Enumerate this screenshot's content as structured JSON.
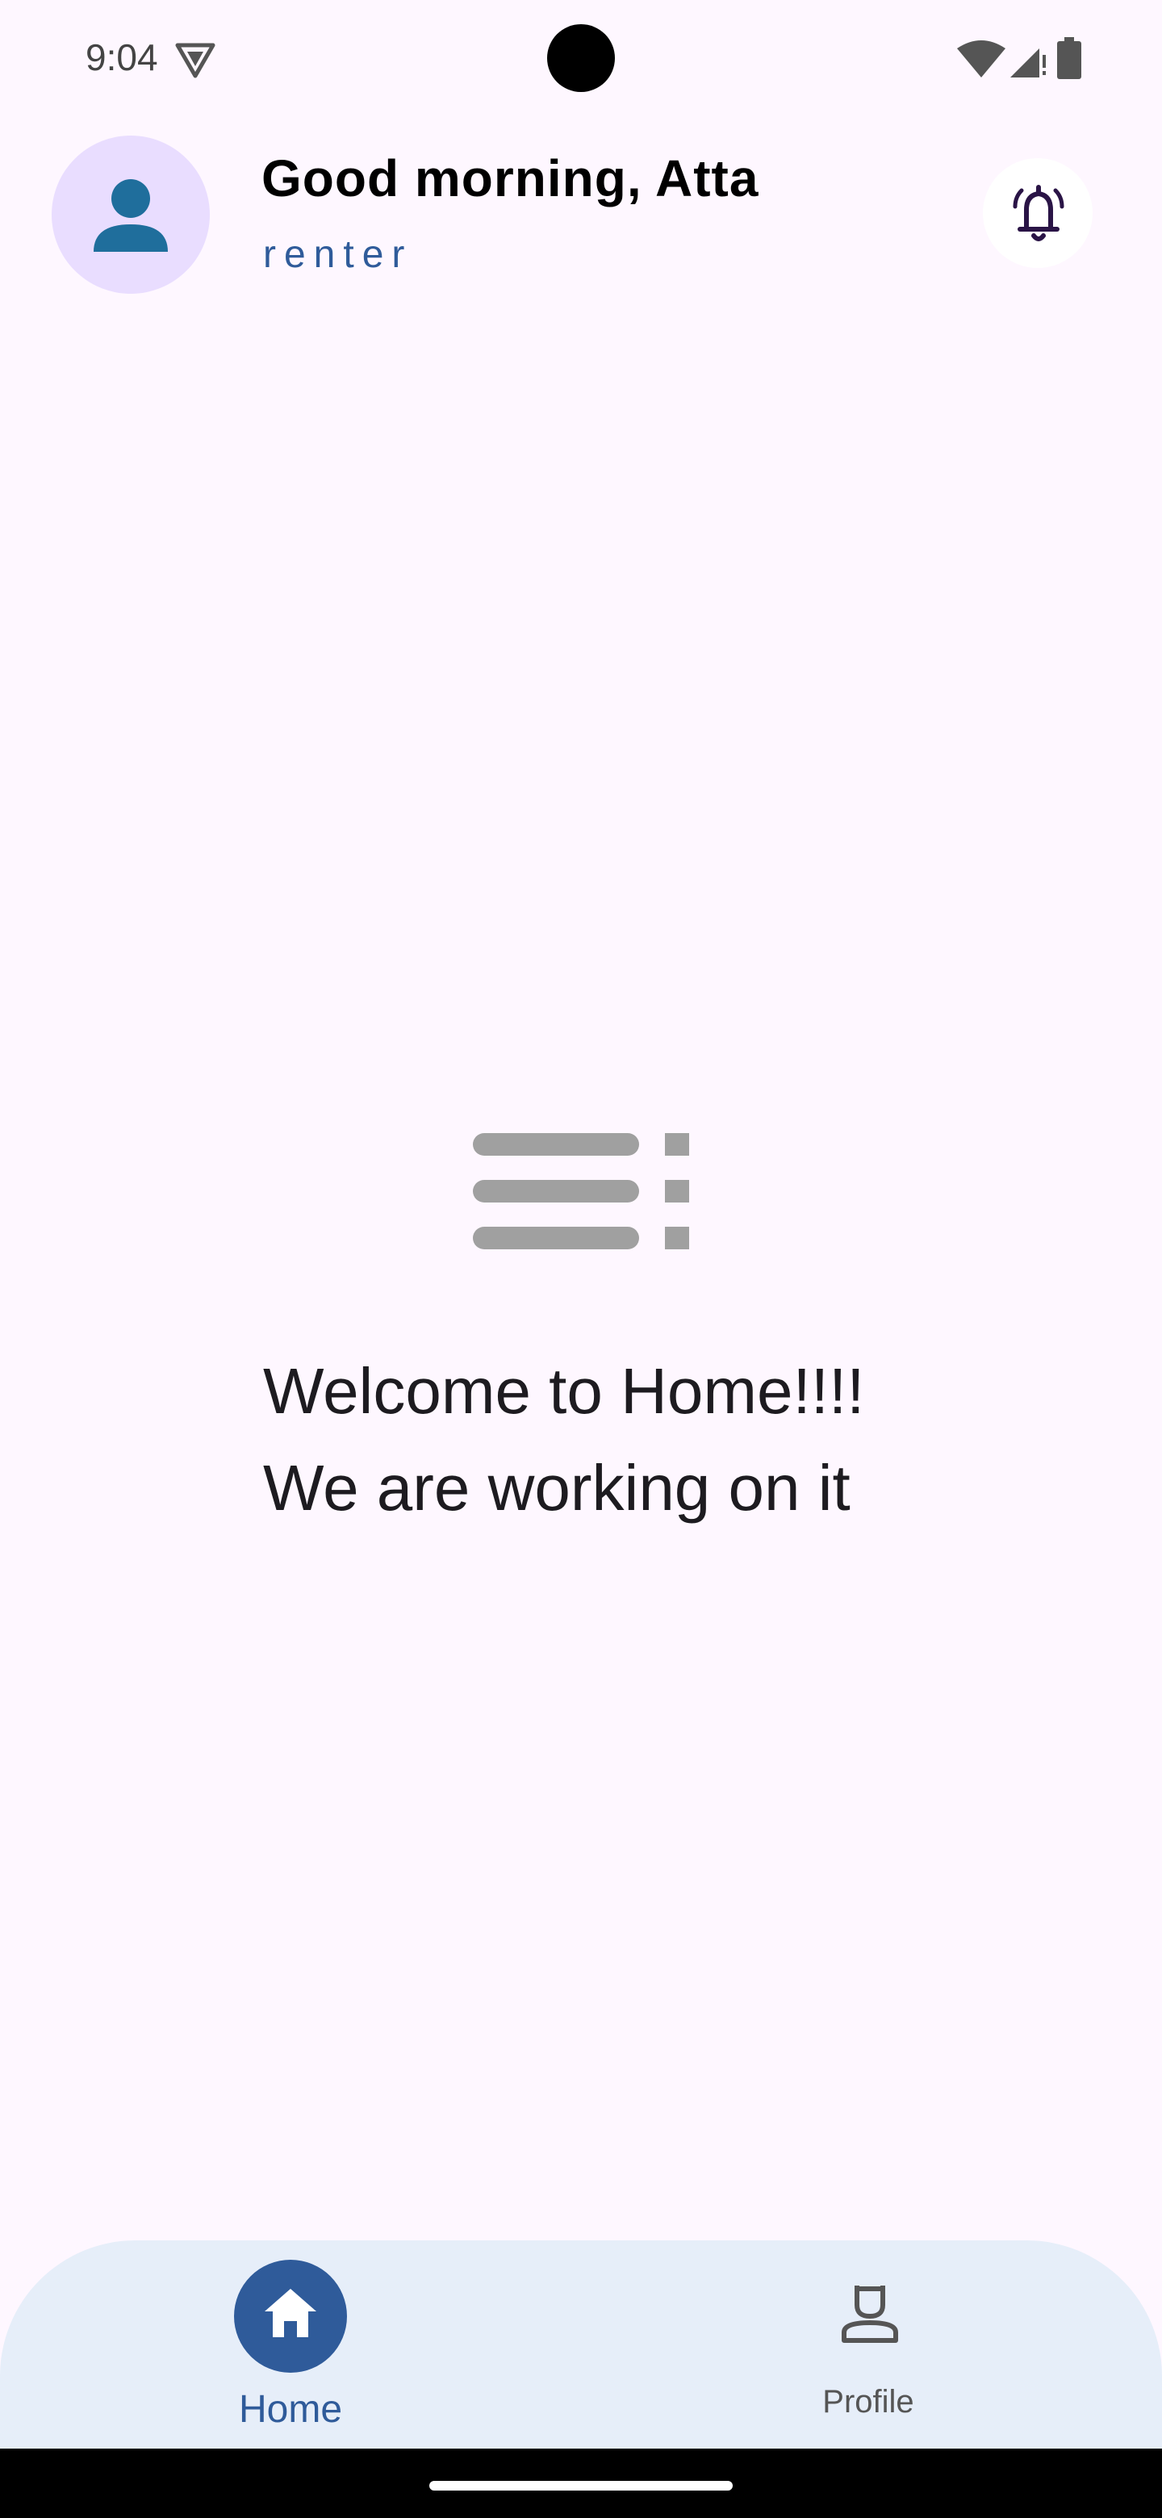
{
  "status_bar": {
    "time": "9:04",
    "icons": [
      "vpn-icon",
      "wifi-icon",
      "signal-icon",
      "battery-icon"
    ]
  },
  "header": {
    "greeting": "Good morning, Atta",
    "role": "renter",
    "avatar_icon": "person-icon",
    "notification_icon": "bell-icon"
  },
  "main": {
    "empty_state_icon": "list-icon",
    "message_line1": "Welcome to Home!!!!",
    "message_line2": "We are working on it"
  },
  "bottom_nav": {
    "items": [
      {
        "label": "Home",
        "icon": "home-icon",
        "selected": true
      },
      {
        "label": "Profile",
        "icon": "profile-icon",
        "selected": false
      }
    ]
  },
  "colors": {
    "background": "#FEF7FF",
    "accent": "#2F5B9A",
    "avatar_bg": "#E9DDFF",
    "nav_bg": "#E6EEF9"
  }
}
